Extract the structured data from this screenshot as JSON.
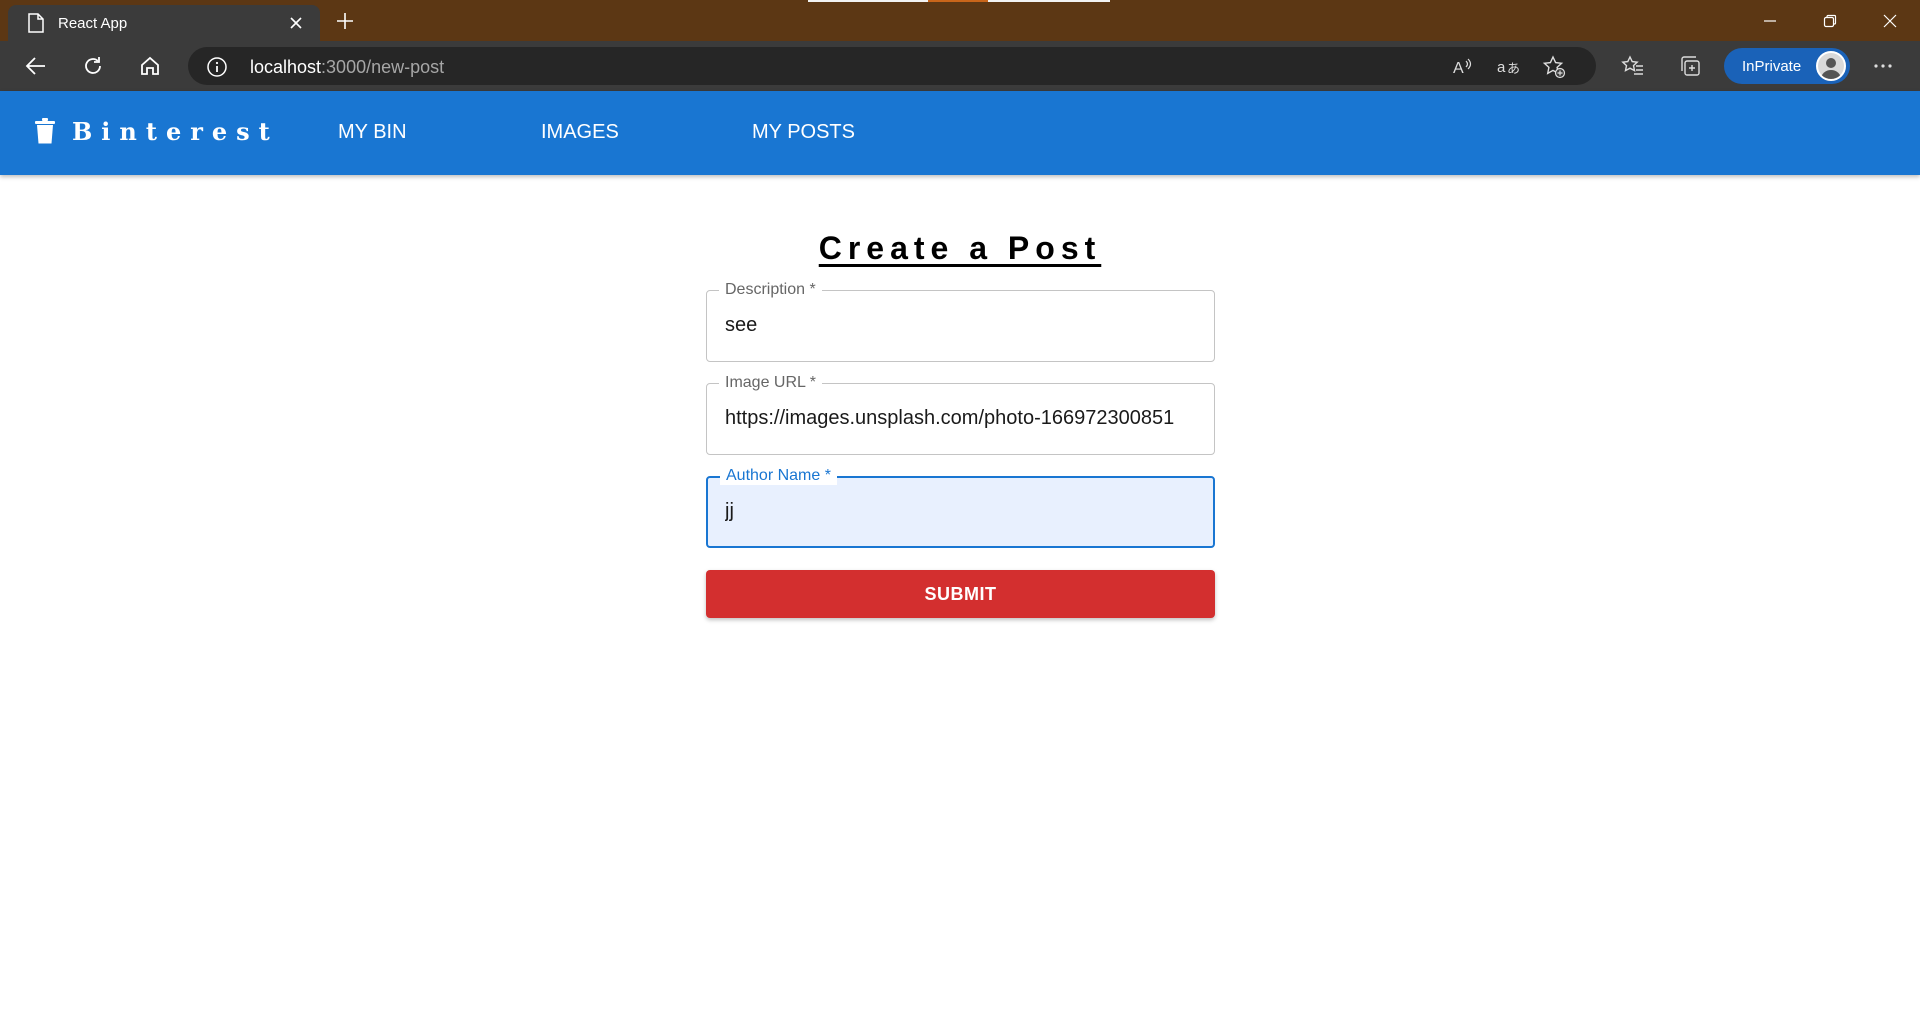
{
  "browser": {
    "tab_title": "React App",
    "url_host": "localhost",
    "url_path": ":3000/new-post",
    "inprivate_label": "InPrivate"
  },
  "app": {
    "brand": "Binterest",
    "nav": [
      "MY BIN",
      "IMAGES",
      "MY POSTS"
    ]
  },
  "form": {
    "title": "Create a Post",
    "description_label": "Description *",
    "description_value": "see",
    "image_url_label": "Image URL *",
    "image_url_value": "https://images.unsplash.com/photo-166972300851",
    "author_label": "Author Name *",
    "author_value": "jj",
    "submit_label": "SUBMIT"
  },
  "colors": {
    "titlebar": "#5c3714",
    "appbar": "#1976d2",
    "submit": "#d32f2f"
  }
}
